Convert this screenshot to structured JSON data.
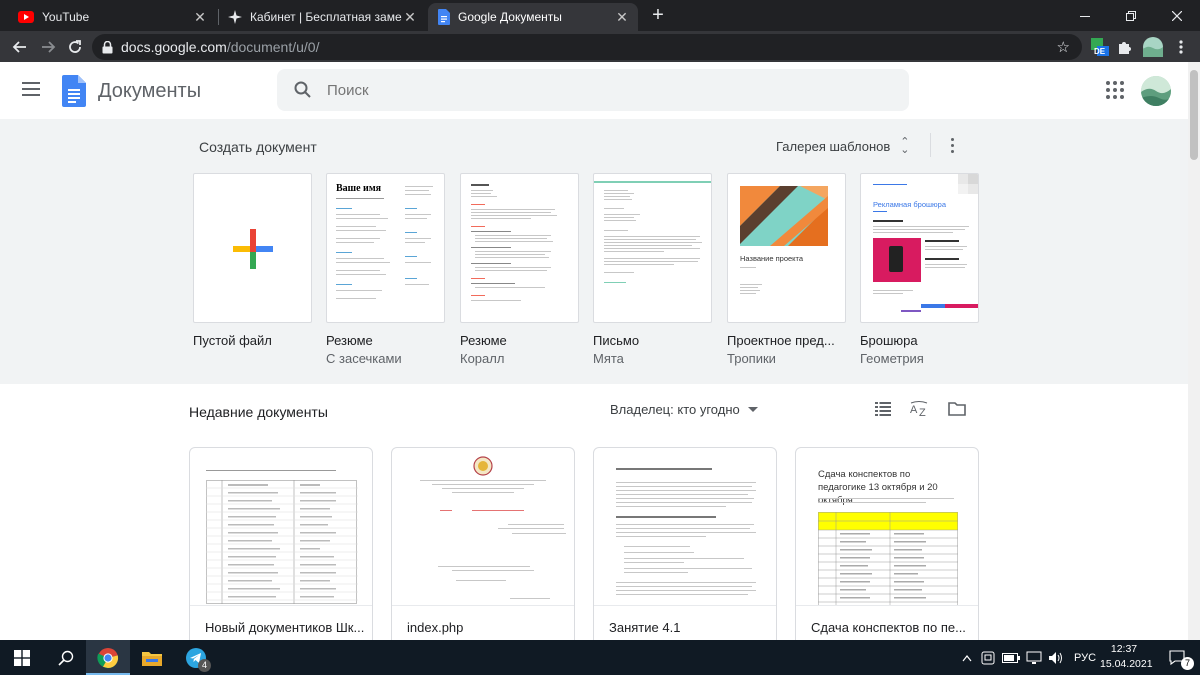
{
  "browser": {
    "tabs": [
      {
        "title": "YouTube",
        "icon": "youtube-icon"
      },
      {
        "title": "Кабинет | Бесплатная замена W",
        "icon": "sparkle-icon"
      },
      {
        "title": "Google Документы",
        "icon": "docs-icon",
        "active": true
      }
    ],
    "url_host": "docs.google.com",
    "url_path": "/document/u/0/",
    "ext_badge": "DE"
  },
  "header": {
    "app_name": "Документы",
    "search_placeholder": "Поиск"
  },
  "templates": {
    "heading": "Создать документ",
    "gallery_label": "Галерея шаблонов",
    "items": [
      {
        "name": "Пустой файл",
        "subtitle": ""
      },
      {
        "name": "Резюме",
        "subtitle": "С засечками"
      },
      {
        "name": "Резюме",
        "subtitle": "Коралл"
      },
      {
        "name": "Письмо",
        "subtitle": "Мята"
      },
      {
        "name": "Проектное пред...",
        "subtitle": "Тропики"
      },
      {
        "name": "Брошюра",
        "subtitle": "Геометрия"
      }
    ],
    "thumb_text": {
      "resume_name": "Ваше имя",
      "project_title": "Название проекта",
      "brochure_title": "Рекламная брошюра"
    }
  },
  "recent": {
    "heading": "Недавние документы",
    "owner_filter": "Владелец: кто угодно",
    "docs": [
      {
        "title": "Новый документиков Шк..."
      },
      {
        "title": "index.php"
      },
      {
        "title": "Занятие 4.1"
      },
      {
        "title": "Сдача конспектов по пе..."
      }
    ],
    "preview4_heading": "Сдача конспектов по педагогике 13 октября и 20 октября"
  },
  "taskbar": {
    "language": "РУС",
    "time": "12:37",
    "date": "15.04.2021",
    "telegram_badge": "4",
    "notif_badge": "7"
  }
}
